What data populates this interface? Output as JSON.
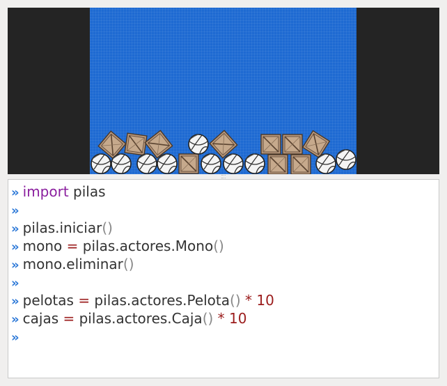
{
  "console": {
    "prompt": "»",
    "lines": [
      {
        "parts": [
          {
            "t": "import",
            "c": "kw"
          },
          {
            "t": " pilas",
            "c": "txt"
          }
        ]
      },
      {
        "parts": []
      },
      {
        "parts": [
          {
            "t": "pilas.iniciar",
            "c": "txt"
          },
          {
            "t": "()",
            "c": "paren"
          }
        ]
      },
      {
        "parts": [
          {
            "t": "mono ",
            "c": "txt"
          },
          {
            "t": "=",
            "c": "op"
          },
          {
            "t": " pilas.actores.Mono",
            "c": "txt"
          },
          {
            "t": "()",
            "c": "paren"
          }
        ]
      },
      {
        "parts": [
          {
            "t": "mono.eliminar",
            "c": "txt"
          },
          {
            "t": "()",
            "c": "paren"
          }
        ]
      },
      {
        "parts": []
      },
      {
        "parts": [
          {
            "t": "pelotas ",
            "c": "txt"
          },
          {
            "t": "=",
            "c": "op"
          },
          {
            "t": " pilas.actores.Pelota",
            "c": "txt"
          },
          {
            "t": "()",
            "c": "paren"
          },
          {
            "t": " * 10",
            "c": "num"
          }
        ]
      },
      {
        "parts": [
          {
            "t": "cajas ",
            "c": "txt"
          },
          {
            "t": "=",
            "c": "op"
          },
          {
            "t": " pilas.actores.Caja",
            "c": "txt"
          },
          {
            "t": "()",
            "c": "paren"
          },
          {
            "t": " * 10",
            "c": "num"
          }
        ]
      },
      {
        "parts": []
      }
    ]
  },
  "game": {
    "colors": {
      "background": "#1e6ad2",
      "side_bars": "#242424",
      "box": "#b8987c",
      "ball": "#f2f2f2"
    },
    "actors": {
      "balls": 10,
      "boxes": 10
    }
  }
}
